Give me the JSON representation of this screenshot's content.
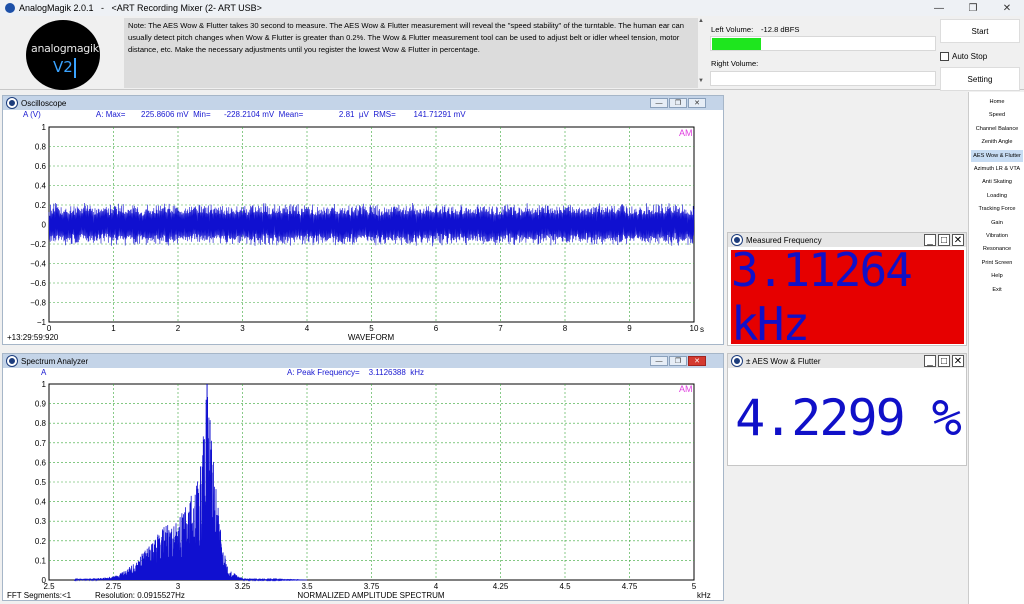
{
  "app": {
    "title": "AnalogMagik 2.0.1   -   <ART Recording Mixer (2- ART USB>",
    "logo_text": "analogmagik",
    "logo_version": "V2"
  },
  "window_controls": {
    "minimize": "—",
    "maximize": "❐",
    "close": "✕"
  },
  "header": {
    "note": "Note:  The AES Wow & Flutter takes 30 second to measure.  The AES Wow & Flutter measurement will reveal the \"speed stability\" of the turntable. The human ear can usually detect pitch changes when Wow & Flutter is greater than 0.2%.   The Wow & Flutter measurement tool can be used to adjust belt or idler wheel tension, motor distance, etc.  Make the necessary adjustments until you register the lowest Wow & Flutter in percentage.",
    "left_volume_label": "Left Volume:",
    "left_volume_value": "-12.8 dBFS",
    "left_volume_level": 0.22,
    "right_volume_label": "Right Volume:",
    "start_label": "Start",
    "auto_stop_label": "Auto Stop",
    "setting_label": "Setting"
  },
  "oscilloscope": {
    "title": "Oscilloscope",
    "info": "A (V)                         A: Max=       225.8606 mV  Min=      -228.2104 mV  Mean=                2.81  µV  RMS=        141.71291 mV",
    "am_label": "AM",
    "timestamp": "+13:29:59:920",
    "xlabel": "WAVEFORM",
    "x_unit": "s"
  },
  "spectrum": {
    "title": "Spectrum Analyzer",
    "y_unit": "A",
    "info": "A: Peak Frequency=    3.1126388  kHz",
    "am_label": "AM",
    "segments": "FFT Segments:<1",
    "resolution": "Resolution: 0.0915527Hz",
    "xlabel": "NORMALIZED AMPLITUDE SPECTRUM",
    "x_unit": "kHz"
  },
  "measured_frequency": {
    "title": "Measured Frequency",
    "value": "3.11264 kHz",
    "bg_color": "#e60000"
  },
  "wow_flutter": {
    "title": "± AES Wow & Flutter",
    "value": "4.2299 %"
  },
  "small_controls": {
    "minimize": "_",
    "maximize": "□",
    "close": "✕"
  },
  "nav": {
    "items": [
      "Home",
      "Speed",
      "Channel Balance",
      "Zenith Angle",
      "AES Wow & Flutter",
      "Azimuth LR & VTA",
      "Anti Skating",
      "Loading",
      "Tracking Force",
      "Gain",
      "Vibration",
      "Resonance",
      "Print Screen",
      "Help",
      "Exit"
    ],
    "active_index": 4
  },
  "chart_data": [
    {
      "type": "line",
      "title": "",
      "xlabel": "WAVEFORM",
      "ylabel": "A (V)",
      "xlim": [
        0,
        10
      ],
      "ylim": [
        -1,
        1
      ],
      "x_ticks": [
        "0",
        "1",
        "2",
        "3",
        "4",
        "5",
        "6",
        "7",
        "8",
        "9",
        "10"
      ],
      "y_ticks": [
        "1",
        "0.8",
        "0.6",
        "0.4",
        "0.2",
        "0",
        "−0.2",
        "−0.4",
        "−0.6",
        "−0.8",
        "−1"
      ],
      "series": [
        {
          "stats": {
            "max_mV": 225.8606,
            "min_mV": -228.2104,
            "rms_mV": 141.71291
          }
        }
      ],
      "grid": true,
      "color": "#1010d0"
    },
    {
      "type": "area",
      "title": "",
      "xlabel": "NORMALIZED AMPLITUDE SPECTRUM",
      "ylabel": "A",
      "xlim": [
        2.5,
        5
      ],
      "ylim": [
        0,
        1
      ],
      "x_ticks": [
        "2.5",
        "2.75",
        "3",
        "3.25",
        "3.5",
        "3.75",
        "4",
        "4.25",
        "4.5",
        "4.75",
        "5"
      ],
      "y_ticks": [
        "1",
        "0.9",
        "0.8",
        "0.7",
        "0.6",
        "0.5",
        "0.4",
        "0.3",
        "0.2",
        "0.1",
        "0"
      ],
      "series": [
        {
          "x": [
            2.6,
            2.7,
            2.75,
            2.8,
            2.85,
            2.9,
            2.95,
            3.0,
            3.03,
            3.06,
            3.09,
            3.11,
            3.125,
            3.14,
            3.17,
            3.2,
            3.25,
            3.3,
            3.5
          ],
          "y": [
            0.005,
            0.01,
            0.02,
            0.05,
            0.12,
            0.2,
            0.28,
            0.3,
            0.4,
            0.45,
            0.6,
            1.0,
            0.95,
            0.55,
            0.2,
            0.05,
            0.01,
            0.005,
            0.0
          ]
        }
      ],
      "peak_khz": 3.1126388,
      "grid": true,
      "color": "#1010d0"
    }
  ]
}
